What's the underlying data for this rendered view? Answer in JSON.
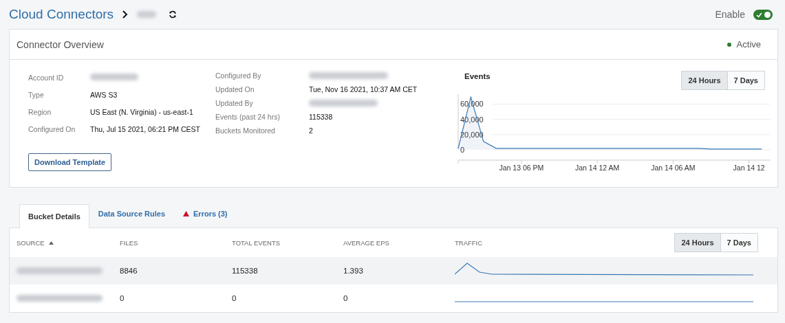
{
  "header": {
    "breadcrumb": "Cloud Connectors",
    "current": {
      "redacted": true
    },
    "enable_label": "Enable",
    "enabled": true
  },
  "overview": {
    "title": "Connector Overview",
    "status": {
      "label": "Active",
      "color": "#2e7d32"
    },
    "left_fields": [
      {
        "label": "Account ID",
        "redacted": true
      },
      {
        "label": "Type",
        "value": "AWS S3",
        "redacted": false
      },
      {
        "label": "Region",
        "value": "US East (N. Virginia) - us-east-1",
        "redacted": false
      },
      {
        "label": "Configured On",
        "value": "Thu, Jul 15 2021, 06:21 PM CEST",
        "redacted": false
      }
    ],
    "right_fields": [
      {
        "label": "Configured By",
        "redacted": true
      },
      {
        "label": "Updated On",
        "value": "Tue, Nov 16 2021, 10:37 AM CET",
        "redacted": false
      },
      {
        "label": "Updated By",
        "redacted": true
      },
      {
        "label": "Events (past 24 hrs)",
        "value": "115338",
        "redacted": false
      },
      {
        "label": "Buckets Monitored",
        "value": "2",
        "redacted": false
      }
    ],
    "download_button": "Download Template",
    "events": {
      "title": "Events",
      "ranges": [
        {
          "label": "24 Hours",
          "selected": true
        },
        {
          "label": "7 Days",
          "selected": false
        }
      ],
      "chart_data": {
        "type": "area",
        "categories": [
          null,
          null,
          null,
          null,
          null,
          "Jan 13 06 PM",
          null,
          null,
          null,
          null,
          null,
          "Jan 14 12 AM",
          null,
          null,
          null,
          null,
          null,
          "Jan 14 06 AM",
          null,
          null,
          null,
          null,
          null,
          "Jan 14 12",
          null
        ],
        "values": [
          2000,
          69000,
          11000,
          2000,
          2000,
          2000,
          2000,
          2000,
          2000,
          2000,
          2000,
          2000,
          2000,
          2000,
          2000,
          2000,
          2000,
          2000,
          2000,
          2000,
          1000,
          1000,
          1000,
          1000,
          1000
        ],
        "ylim": [
          0,
          73000
        ],
        "grid": true,
        "yticks": [
          {
            "value": 0,
            "label": "0"
          },
          {
            "value": 20000,
            "label": "20,000"
          },
          {
            "value": 40000,
            "label": "40,000"
          },
          {
            "value": 60000,
            "label": "60,000"
          }
        ]
      }
    }
  },
  "tabs": [
    {
      "label": "Bucket Details",
      "selected": true,
      "warning": false
    },
    {
      "label": "Data Source Rules",
      "selected": false,
      "warning": false
    },
    {
      "label": "Errors (3)",
      "selected": false,
      "warning": true
    }
  ],
  "table": {
    "columns": [
      {
        "label": "SOURCE",
        "sorted": true
      },
      {
        "label": "FILES",
        "sorted": false
      },
      {
        "label": "TOTAL EVENTS",
        "sorted": false
      },
      {
        "label": "AVERAGE EPS",
        "sorted": false
      },
      {
        "label": "TRAFFIC",
        "sorted": false
      }
    ],
    "ranges": [
      {
        "label": "24 Hours",
        "selected": true
      },
      {
        "label": "7 Days",
        "selected": false
      }
    ],
    "rows": [
      {
        "source": {
          "redacted": true
        },
        "files": "8846",
        "total_events": "115338",
        "average_eps": "1.393",
        "highlighted": true
      },
      {
        "source": {
          "redacted": true
        },
        "files": "0",
        "total_events": "0",
        "average_eps": "0",
        "highlighted": false
      }
    ]
  }
}
